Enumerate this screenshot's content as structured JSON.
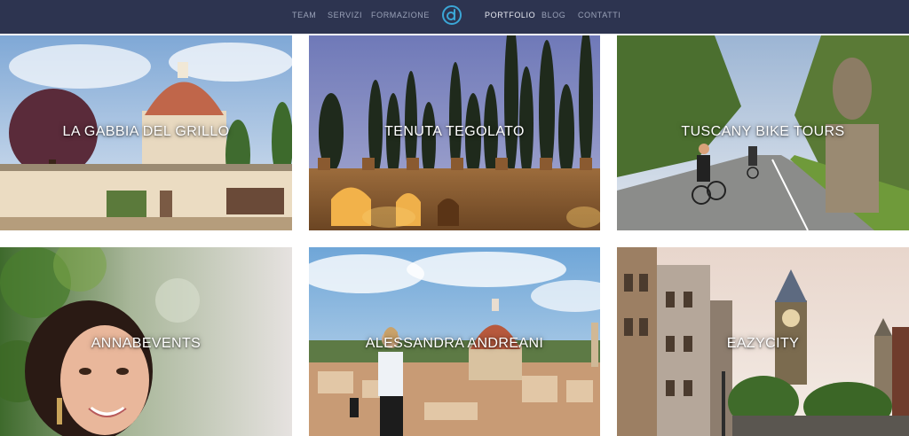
{
  "nav": {
    "left_items": [
      {
        "label": "TEAM"
      },
      {
        "label": "SERVIZI"
      },
      {
        "label": "FORMAZIONE"
      }
    ],
    "right_items": [
      {
        "label": "PORTFOLIO",
        "active": true
      },
      {
        "label": "BLOG"
      },
      {
        "label": "CONTATTI"
      }
    ],
    "logo_icon": "d-circle-logo-icon"
  },
  "portfolio": {
    "items": [
      {
        "title": "LA GABBIA DEL GRILLO",
        "image": "florence-villa-duomo-photo"
      },
      {
        "title": "TENUTA TEGOLATO",
        "image": "cypress-stone-wall-dusk-photo"
      },
      {
        "title": "TUSCANY BIKE TOURS",
        "image": "cyclists-country-road-photo"
      },
      {
        "title": "ANNABEVENTS",
        "image": "smiling-woman-portrait-photo"
      },
      {
        "title": "ALESSANDRA ANDREANI",
        "image": "woman-florence-panorama-photo"
      },
      {
        "title": "EAZYCITY",
        "image": "london-big-ben-street-photo"
      }
    ]
  },
  "colors": {
    "nav_bg": "#2d3450",
    "nav_text": "#9aa2b8",
    "nav_active": "#e8eaf2",
    "logo_accent": "#3ba6d6"
  }
}
